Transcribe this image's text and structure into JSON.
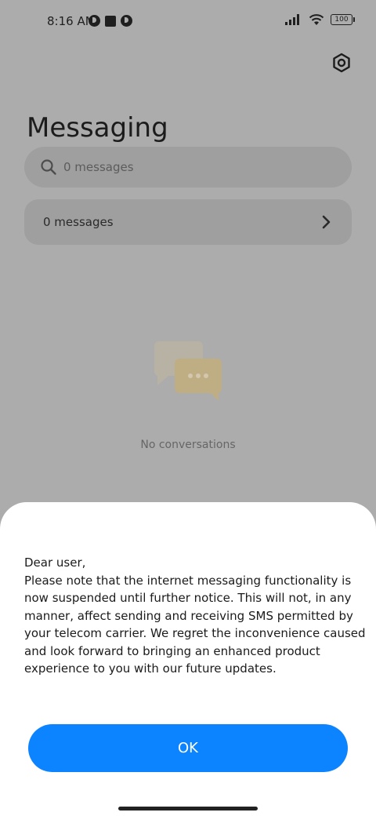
{
  "status_bar": {
    "time": "8:16 AM",
    "battery": "100"
  },
  "header": {
    "title": "Messaging"
  },
  "search": {
    "placeholder": "0 messages"
  },
  "messages_row": {
    "label": "0 messages"
  },
  "empty_state": {
    "label": "No conversations"
  },
  "dialog": {
    "message": "Dear user,\nPlease note that the internet messaging functionality is now suspended until further notice. This will not, in any manner, affect sending and receiving SMS permitted by your telecom carrier. We regret the inconvenience caused and look forward to bringing an enhanced product experience to you with our future updates.",
    "ok_label": "OK"
  },
  "colors": {
    "accent": "#0d84ff",
    "dim_background": "#acacac"
  }
}
